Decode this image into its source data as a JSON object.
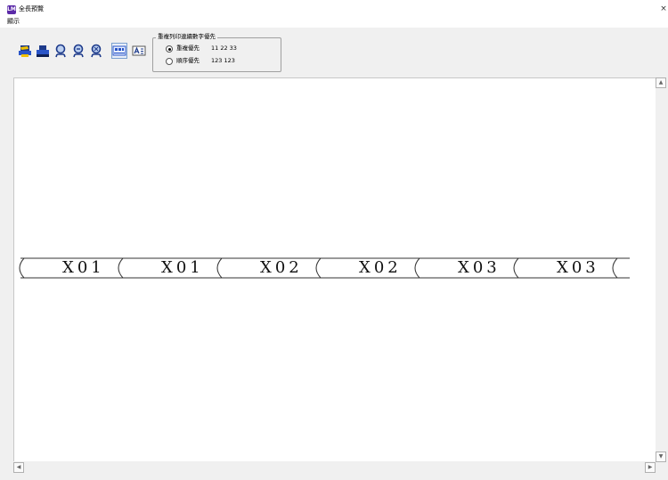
{
  "window": {
    "title": "全長預覽",
    "close_glyph": "×",
    "app_icon_text": "LM"
  },
  "menu": {
    "items": [
      "顯示"
    ]
  },
  "toolbar": {
    "buttons": [
      {
        "name": "print-icon",
        "pressed": false
      },
      {
        "name": "printer-icon",
        "pressed": false
      },
      {
        "name": "zoom-in-icon",
        "pressed": false
      },
      {
        "name": "zoom-out-icon",
        "pressed": false
      },
      {
        "name": "zoom-fit-icon",
        "pressed": false
      },
      {
        "name": "ruler-icon",
        "pressed": true
      },
      {
        "name": "text-size-icon",
        "pressed": false
      }
    ]
  },
  "print_order": {
    "title": "重複列印連續數字優先",
    "options": [
      {
        "label": "重複優先",
        "sample": "11 22 33",
        "checked": true
      },
      {
        "label": "順序優先",
        "sample": "123 123",
        "checked": false
      }
    ]
  },
  "preview": {
    "labels": [
      "X01",
      "X01",
      "X02",
      "X02",
      "X03",
      "X03"
    ]
  },
  "scrollbars": {
    "up_glyph": "▲",
    "down_glyph": "▼",
    "left_glyph": "◀",
    "right_glyph": "▶"
  }
}
